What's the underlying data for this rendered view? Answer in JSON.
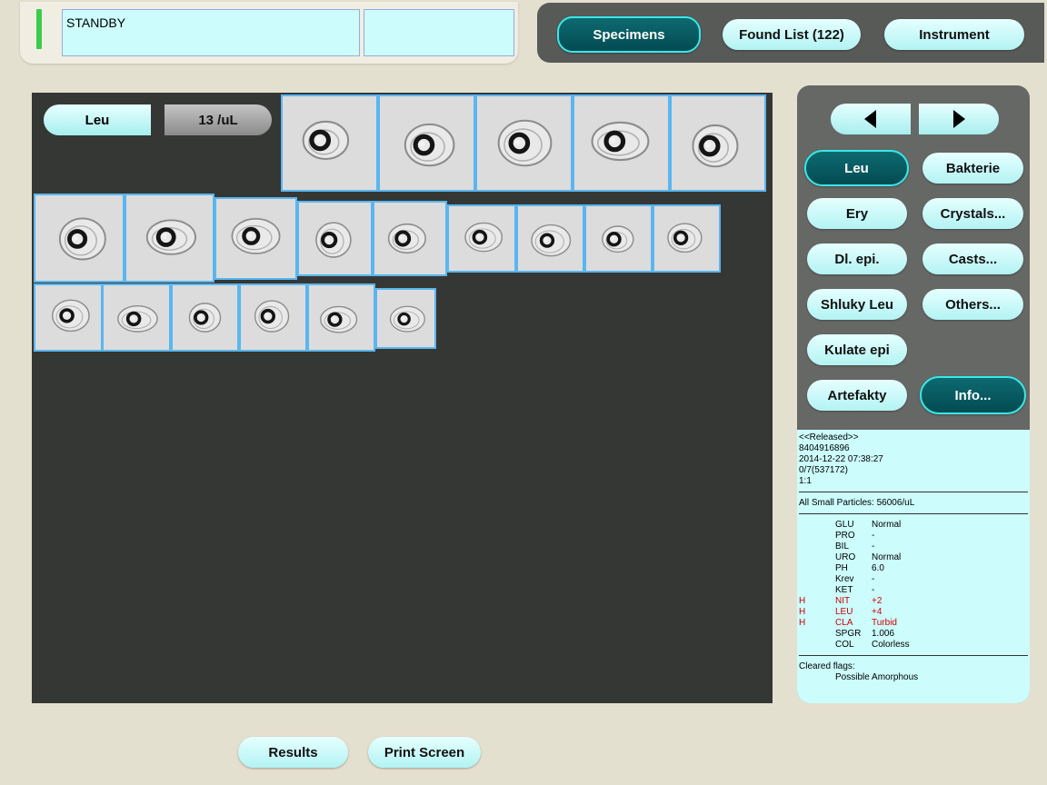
{
  "status": {
    "text": "STANDBY"
  },
  "nav": {
    "specimens": "Specimens",
    "found_list": "Found List (122)",
    "instrument": "Instrument"
  },
  "viewer": {
    "class_label": "Leu",
    "count": "13 /uL"
  },
  "categories": {
    "leu": "Leu",
    "bakterie": "Bakterie",
    "ery": "Ery",
    "crystals": "Crystals...",
    "dl_epi": "Dl. epi.",
    "casts": "Casts...",
    "shluky_leu": "Shluky Leu",
    "others": "Others...",
    "kulate_epi": "Kulate epi",
    "artefakty": "Artefakty",
    "info": "Info..."
  },
  "info": {
    "status": "<<Released>>",
    "id": "8404916896",
    "datetime": "2014-12-22 07:38:27",
    "rack": "0/7(537172)",
    "dilution": "1:1",
    "small_particles": "All Small Particles: 56006/uL",
    "chem": [
      {
        "flag": "",
        "key": "GLU",
        "value": "Normal"
      },
      {
        "flag": "",
        "key": "PRO",
        "value": "-"
      },
      {
        "flag": "",
        "key": "BIL",
        "value": "-"
      },
      {
        "flag": "",
        "key": "URO",
        "value": "Normal"
      },
      {
        "flag": "",
        "key": "PH",
        "value": "6.0"
      },
      {
        "flag": "",
        "key": "Krev",
        "value": "-"
      },
      {
        "flag": "",
        "key": "KET",
        "value": "-"
      },
      {
        "flag": "H",
        "key": "NIT",
        "value": "+2"
      },
      {
        "flag": "H",
        "key": "LEU",
        "value": "+4"
      },
      {
        "flag": "H",
        "key": "CLA",
        "value": "Turbid"
      },
      {
        "flag": "",
        "key": "SPGR",
        "value": "1.006"
      },
      {
        "flag": "",
        "key": "COL",
        "value": "Colorless"
      }
    ],
    "cleared_label": "Cleared flags:",
    "cleared_value": "Possible Amorphous"
  },
  "bottom": {
    "results": "Results",
    "print_screen": "Print Screen"
  },
  "colors": {
    "active_button": "#034b52",
    "pill": "#b3f3f3",
    "flag_red": "#d00000",
    "cell_border": "#5ab6f0"
  }
}
